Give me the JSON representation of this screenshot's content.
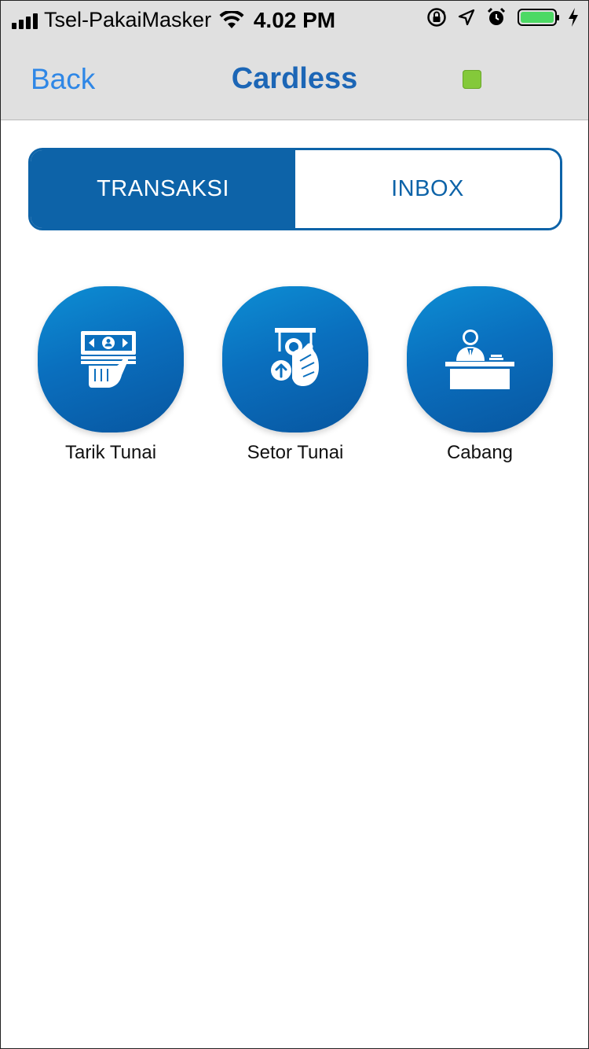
{
  "status_bar": {
    "carrier": "Tsel-PakaiMasker",
    "time": "4.02 PM",
    "battery_level": 1.0,
    "icons": [
      "signal-icon",
      "wifi-icon",
      "rotation-lock-icon",
      "location-icon",
      "alarm-icon",
      "battery-icon",
      "charging-icon"
    ]
  },
  "nav": {
    "back_label": "Back",
    "title": "Cardless",
    "indicator_color": "#84c93a"
  },
  "tabs": [
    {
      "label": "TRANSAKSI",
      "active": true
    },
    {
      "label": "INBOX",
      "active": false
    }
  ],
  "menu": [
    {
      "label": "Tarik Tunai",
      "icon": "cash-withdrawal-icon"
    },
    {
      "label": "Setor Tunai",
      "icon": "cash-deposit-icon"
    },
    {
      "label": "Cabang",
      "icon": "branch-teller-icon"
    }
  ],
  "colors": {
    "brand_blue": "#0d63a8",
    "link_blue": "#2f87e6",
    "title_blue": "#1c66b6"
  }
}
